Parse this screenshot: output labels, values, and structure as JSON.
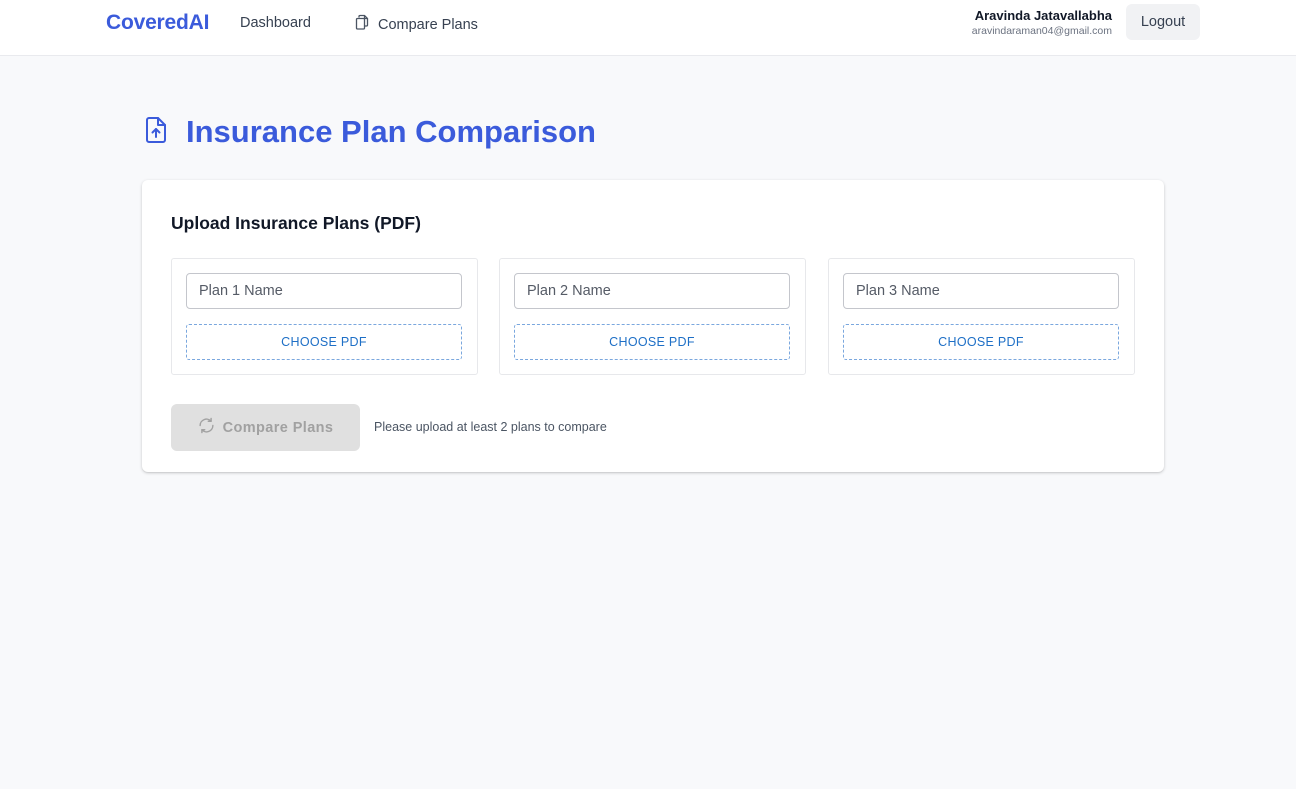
{
  "header": {
    "brand": "CoveredAI",
    "nav": {
      "dashboard": "Dashboard",
      "compare_plans": "Compare Plans"
    },
    "user": {
      "name": "Aravinda Jatavallabha",
      "email": "aravindaraman04@gmail.com"
    },
    "logout_label": "Logout"
  },
  "page": {
    "title": "Insurance Plan Comparison"
  },
  "upload": {
    "title": "Upload Insurance Plans (PDF)",
    "plans": [
      {
        "placeholder": "Plan 1 Name",
        "value": "",
        "choose_label": "CHOOSE PDF"
      },
      {
        "placeholder": "Plan 2 Name",
        "value": "",
        "choose_label": "CHOOSE PDF"
      },
      {
        "placeholder": "Plan 3 Name",
        "value": "",
        "choose_label": "CHOOSE PDF"
      }
    ],
    "compare_button": {
      "label": "Compare Plans",
      "disabled": true
    },
    "hint": "Please upload at least 2 plans to compare"
  },
  "colors": {
    "brand": "#3b5bdb",
    "link_blue": "#1e6fc6",
    "page_bg": "#f8f9fb",
    "disabled_bg": "#e0e0e0"
  },
  "icons": {
    "nav_compare": "copy-icon",
    "title": "file-upload-icon",
    "compare_button": "refresh-icon"
  }
}
